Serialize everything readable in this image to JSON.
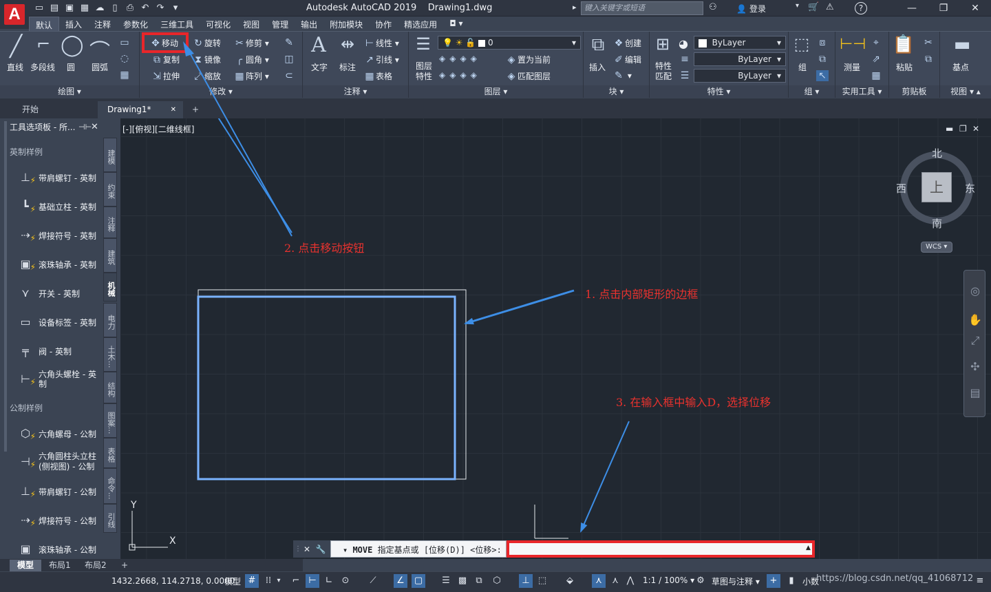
{
  "app": {
    "title": "Autodesk AutoCAD 2019",
    "document": "Drawing1.dwg",
    "logo": "A"
  },
  "search": {
    "placeholder": "键入关键字或短语"
  },
  "account": {
    "login": "登录"
  },
  "ribbon_tabs": [
    "默认",
    "插入",
    "注释",
    "参数化",
    "三维工具",
    "可视化",
    "视图",
    "管理",
    "输出",
    "附加模块",
    "协作",
    "精选应用"
  ],
  "ribbon": {
    "draw": {
      "title": "绘图",
      "line": "直线",
      "polyline": "多段线",
      "circle": "圆",
      "arc": "圆弧"
    },
    "modify": {
      "title": "修改",
      "move": "移动",
      "rotate": "旋转",
      "trim": "修剪",
      "copy": "复制",
      "mirror": "镜像",
      "fillet": "圆角",
      "stretch": "拉伸",
      "scale": "缩放",
      "array": "阵列"
    },
    "annotation": {
      "title": "注释",
      "text": "文字",
      "dimension": "标注",
      "linear": "线性",
      "leader": "引线",
      "table": "表格"
    },
    "layers": {
      "title": "图层",
      "properties": "图层特性",
      "layer_value": "0",
      "set_current": "置为当前",
      "match_layer": "匹配图层"
    },
    "block": {
      "title": "块",
      "insert": "插入",
      "create": "创建",
      "edit": "编辑"
    },
    "properties": {
      "title": "特性",
      "match": "特性匹配",
      "color": "ByLayer",
      "linetype": "ByLayer",
      "lineweight": "ByLayer"
    },
    "groups": {
      "title": "组",
      "group": "组"
    },
    "utilities": {
      "title": "实用工具",
      "measure": "测量"
    },
    "clipboard": {
      "title": "剪贴板",
      "paste": "粘贴"
    },
    "view": {
      "title": "视图",
      "base": "基点"
    }
  },
  "doc_tabs": {
    "start": "开始",
    "drawing": "Drawing1*",
    "add": "+"
  },
  "palette": {
    "title": "工具选项板 - 所...",
    "groups": [
      "英制样例",
      "公制样例"
    ],
    "items": [
      "带肩螺钉 - 英制",
      "基础立柱 - 英制",
      "焊接符号 - 英制",
      "滚珠轴承 - 英制",
      "开关 - 英制",
      "设备标签 - 英制",
      "阀 - 英制",
      "六角头螺栓 - 英制",
      "六角螺母 - 公制",
      "六角圆柱头立柱 (侧视图) - 公制",
      "带肩螺钉 - 公制",
      "焊接符号 - 公制",
      "滚珠轴承 - 公制"
    ],
    "vtabs": [
      "建模",
      "约束",
      "注释",
      "建筑",
      "机械",
      "电力",
      "土木...",
      "结构",
      "图案...",
      "表格",
      "命令...",
      "引线"
    ]
  },
  "viewport": {
    "label": "[-][俯视][二维线框]",
    "compass": {
      "north": "北",
      "south": "南",
      "east": "东",
      "west": "西",
      "top": "上"
    },
    "wcs": "WCS",
    "ucs_x": "X",
    "ucs_y": "Y"
  },
  "command": {
    "name": "MOVE",
    "prompt": "指定基点或 [位移(D)] <位移>:",
    "input": ""
  },
  "layout_tabs": [
    "模型",
    "布局1",
    "布局2"
  ],
  "status": {
    "coords": "1432.2668, 114.2718, 0.0000",
    "model": "模型",
    "scale": "1:1 / 100%",
    "workspace": "草图与注释",
    "units": "小数"
  },
  "annotations": [
    "1. 点击内部矩形的边框",
    "2. 点击移动按钮",
    "3. 在输入框中输入D，选择位移"
  ],
  "watermark": "https://blog.csdn.net/qq_41068712",
  "colors": {
    "accent_red": "#e8262a",
    "annotation_blue": "#3d8ee6",
    "selected_rect": "#7ab3ff",
    "canvas_bg": "#212831"
  }
}
